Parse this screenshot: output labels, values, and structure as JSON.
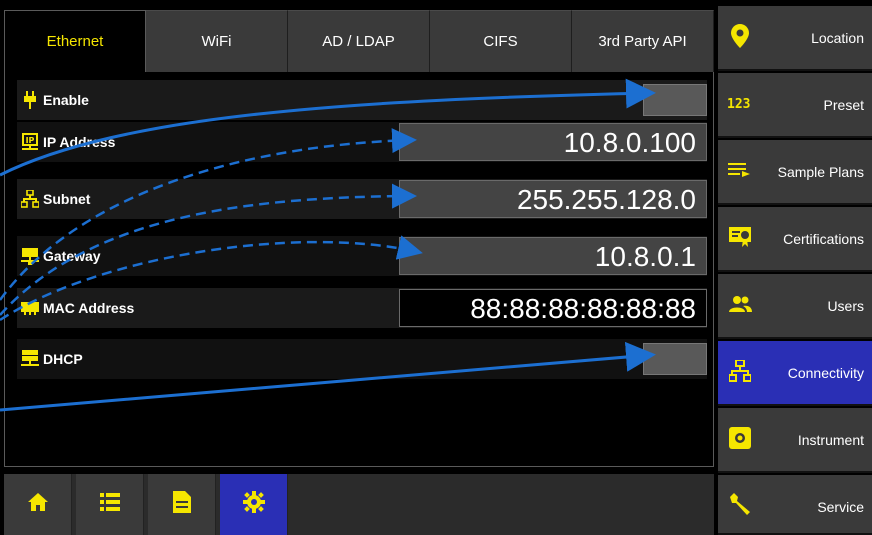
{
  "tabs": [
    {
      "label": "Ethernet",
      "active": true
    },
    {
      "label": "WiFi",
      "active": false
    },
    {
      "label": "AD / LDAP",
      "active": false
    },
    {
      "label": "CIFS",
      "active": false
    },
    {
      "label": "3rd Party API",
      "active": false
    }
  ],
  "fields": {
    "enable": {
      "label": "Enable",
      "icon": "plug-icon"
    },
    "ip": {
      "label": "IP Address",
      "value": "10.8.0.100",
      "icon": "ip-icon"
    },
    "subnet": {
      "label": "Subnet",
      "value": "255.255.128.0",
      "icon": "network-icon"
    },
    "gateway": {
      "label": "Gateway",
      "value": "10.8.0.1",
      "icon": "monitor-network-icon"
    },
    "mac": {
      "label": "MAC Address",
      "value": "88:88:88:88:88:88",
      "icon": "ethernet-card-icon"
    },
    "dhcp": {
      "label": "DHCP",
      "icon": "server-network-icon"
    }
  },
  "sidebar": {
    "items": [
      {
        "label": "Location",
        "icon": "map-marker-icon"
      },
      {
        "label": "Preset",
        "icon": "numeric-123-icon"
      },
      {
        "label": "Sample Plans",
        "icon": "list-arrow-icon"
      },
      {
        "label": "Certifications",
        "icon": "certificate-icon"
      },
      {
        "label": "Users",
        "icon": "users-icon"
      },
      {
        "label": "Connectivity",
        "icon": "network-icon",
        "active": true
      },
      {
        "label": "Instrument",
        "icon": "gear-icon"
      },
      {
        "label": "Service",
        "icon": "wrench-icon"
      }
    ]
  },
  "bottombar": {
    "items": [
      {
        "icon": "home-icon"
      },
      {
        "icon": "list-icon"
      },
      {
        "icon": "document-icon"
      },
      {
        "icon": "gear-icon",
        "active": true
      }
    ]
  },
  "colors": {
    "accent_yellow": "#f5e600",
    "active_blue": "#2a2fb5",
    "arrow_blue": "#1c6fd1"
  }
}
